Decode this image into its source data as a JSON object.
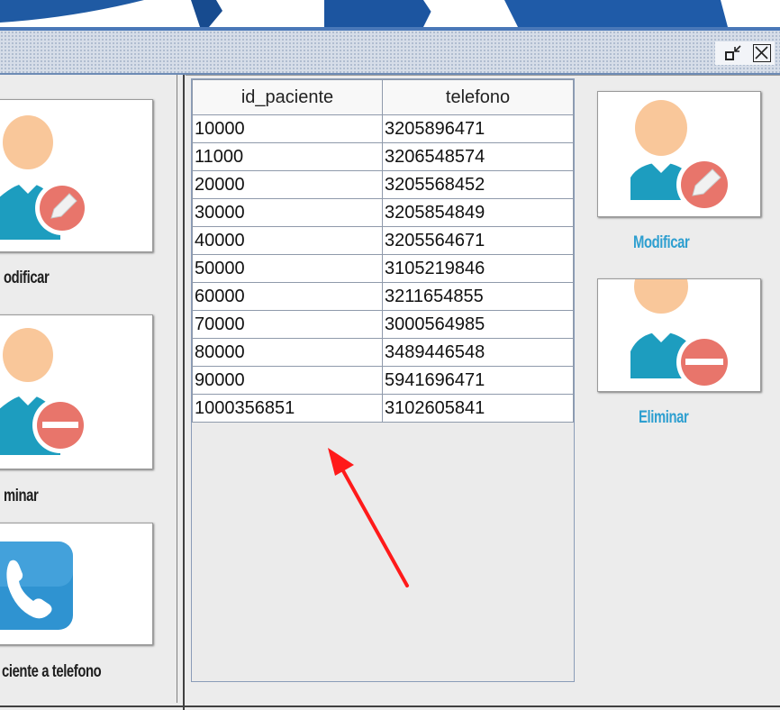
{
  "window": {
    "controls": {
      "minimize_icon": "restore-down-icon",
      "close_icon": "close-icon"
    }
  },
  "left_panel": {
    "buttons": [
      {
        "caption": "odificar",
        "icon": "user-edit-icon"
      },
      {
        "caption": "minar",
        "icon": "user-remove-icon"
      },
      {
        "caption": "ciente  a telefono",
        "icon": "phone-icon"
      }
    ]
  },
  "table": {
    "columns": [
      "id_paciente",
      "telefono"
    ],
    "rows": [
      [
        "10000",
        "3205896471"
      ],
      [
        "11000",
        "3206548574"
      ],
      [
        "20000",
        "3205568452"
      ],
      [
        "30000",
        "3205854849"
      ],
      [
        "40000",
        "3205564671"
      ],
      [
        "50000",
        "3105219846"
      ],
      [
        "60000",
        "3211654855"
      ],
      [
        "70000",
        "3000564985"
      ],
      [
        "80000",
        "3489446548"
      ],
      [
        "90000",
        "5941696471"
      ],
      [
        "1000356851",
        "3102605841"
      ]
    ]
  },
  "right_panel": {
    "buttons": [
      {
        "caption": "Modificar",
        "icon": "user-edit-icon"
      },
      {
        "caption": "Eliminar",
        "icon": "user-remove-icon"
      }
    ]
  },
  "colors": {
    "title_bar_border": "#4a78b8",
    "caption_blue": "#2e9fd0",
    "avatar_body": "#1d9dbf",
    "avatar_head": "#f9c79a",
    "badge": "#e8756b",
    "annotation_arrow": "#ff1a1a"
  },
  "annotation": {
    "type": "arrow",
    "color": "#ff1a1a"
  }
}
